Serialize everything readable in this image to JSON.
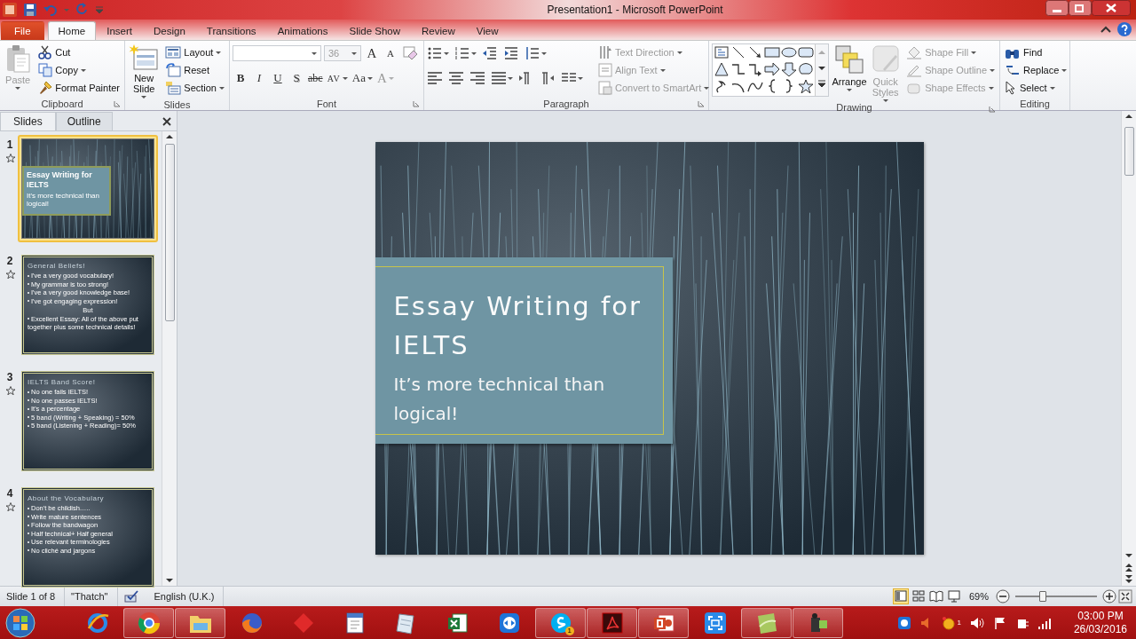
{
  "window": {
    "title": "Presentation1 - Microsoft PowerPoint"
  },
  "ribbon_tabs": [
    {
      "label": "File",
      "kind": "file",
      "selected": false
    },
    {
      "label": "Home",
      "kind": "tab",
      "selected": true
    },
    {
      "label": "Insert",
      "kind": "tab",
      "selected": false
    },
    {
      "label": "Design",
      "kind": "tab",
      "selected": false
    },
    {
      "label": "Transitions",
      "kind": "tab",
      "selected": false
    },
    {
      "label": "Animations",
      "kind": "tab",
      "selected": false
    },
    {
      "label": "Slide Show",
      "kind": "tab",
      "selected": false
    },
    {
      "label": "Review",
      "kind": "tab",
      "selected": false
    },
    {
      "label": "View",
      "kind": "tab",
      "selected": false
    }
  ],
  "ribbon_groups": [
    {
      "title": "Clipboard",
      "kind": "clipboard",
      "launcher": true,
      "commands": [
        {
          "label": "Paste",
          "kind": "large",
          "disabled": true,
          "dropdown": true
        },
        {
          "label": "Cut",
          "kind": "small",
          "disabled": false,
          "dropdown": false
        },
        {
          "label": "Copy",
          "kind": "small",
          "disabled": false,
          "dropdown": true
        },
        {
          "label": "Format Painter",
          "kind": "small",
          "disabled": false,
          "dropdown": false
        }
      ]
    },
    {
      "title": "Slides",
      "kind": "slides",
      "launcher": false,
      "commands": [
        {
          "label": "New Slide",
          "kind": "large",
          "disabled": false,
          "dropdown": true
        },
        {
          "label": "Layout",
          "kind": "small",
          "disabled": false,
          "dropdown": true
        },
        {
          "label": "Reset",
          "kind": "small",
          "disabled": false,
          "dropdown": false
        },
        {
          "label": "Section",
          "kind": "small",
          "disabled": false,
          "dropdown": true
        }
      ]
    },
    {
      "title": "Font",
      "kind": "font",
      "launcher": true,
      "commands": [
        {
          "kind": "font_name",
          "disabled": false,
          "dropdown": true
        },
        {
          "label": "36",
          "kind": "font_size",
          "disabled": true,
          "dropdown": true
        },
        {
          "label": "A",
          "kind": "grow",
          "disabled": false,
          "dropdown": false
        },
        {
          "label": "A",
          "kind": "shrink",
          "disabled": false,
          "dropdown": false
        },
        {
          "kind": "clear",
          "disabled": false,
          "dropdown": false
        },
        {
          "label": "B",
          "kind": "bold",
          "disabled": false,
          "dropdown": false
        },
        {
          "label": "I",
          "kind": "italic",
          "disabled": false,
          "dropdown": false
        },
        {
          "label": "U",
          "kind": "underline",
          "disabled": false,
          "dropdown": false
        },
        {
          "label": "S",
          "kind": "shadow",
          "disabled": false,
          "dropdown": false
        },
        {
          "label": "abc",
          "kind": "strike",
          "disabled": false,
          "dropdown": false
        },
        {
          "label": "AV",
          "kind": "spacing",
          "disabled": false,
          "dropdown": true
        },
        {
          "label": "Aa",
          "kind": "case",
          "disabled": false,
          "dropdown": true
        },
        {
          "label": "A",
          "kind": "color",
          "disabled": true,
          "dropdown": true
        }
      ]
    },
    {
      "title": "Paragraph",
      "kind": "paragraph",
      "launcher": true,
      "commands": [
        {
          "label": "Text Direction",
          "kind": "small",
          "disabled": true,
          "dropdown": true
        },
        {
          "label": "Align Text",
          "kind": "small",
          "disabled": true,
          "dropdown": true
        },
        {
          "label": "Convert to SmartArt",
          "kind": "small",
          "disabled": true,
          "dropdown": true
        }
      ]
    },
    {
      "title": "Drawing",
      "kind": "drawing",
      "launcher": true,
      "commands": [
        {
          "label": "Arrange",
          "kind": "large",
          "disabled": false,
          "dropdown": true
        },
        {
          "label": "Quick Styles",
          "kind": "large",
          "disabled": true,
          "dropdown": true
        },
        {
          "label": "Shape Fill",
          "kind": "small",
          "disabled": true,
          "dropdown": true
        },
        {
          "label": "Shape Outline",
          "kind": "small",
          "disabled": true,
          "dropdown": true
        },
        {
          "label": "Shape Effects",
          "kind": "small",
          "disabled": true,
          "dropdown": true
        }
      ]
    },
    {
      "title": "Editing",
      "kind": "editing",
      "launcher": false,
      "commands": [
        {
          "label": "Find",
          "kind": "small",
          "disabled": false,
          "dropdown": false
        },
        {
          "label": "Replace",
          "kind": "small",
          "disabled": false,
          "dropdown": true
        },
        {
          "label": "Select",
          "kind": "small",
          "disabled": false,
          "dropdown": true
        }
      ]
    }
  ],
  "pane_tabs": [
    {
      "label": "Slides",
      "selected": true
    },
    {
      "label": "Outline",
      "selected": false
    }
  ],
  "slides": [
    {
      "number": "1",
      "kind": "title",
      "selected": true,
      "title": "Essay Writing for IELTS",
      "subtitle": "It's more technical than logical!"
    },
    {
      "number": "2",
      "kind": "bullets",
      "selected": false,
      "title": "General Beliefs!",
      "lines": [
        {
          "text": "I've a very good vocabulary!",
          "kind": "bullet"
        },
        {
          "text": "My grammar is too strong!",
          "kind": "bullet"
        },
        {
          "text": "I've a very good knowledge base!",
          "kind": "bullet"
        },
        {
          "text": "I've got engaging expression!",
          "kind": "bullet"
        },
        {
          "text": "But",
          "kind": "center"
        },
        {
          "text": "Excellent Essay: All of the above put together plus some technical details!",
          "kind": "bullet"
        }
      ]
    },
    {
      "number": "3",
      "kind": "bullets",
      "selected": false,
      "title": "IELTS Band Score!",
      "lines": [
        {
          "text": "No one fails IELTS!",
          "kind": "bullet"
        },
        {
          "text": "No one passes IELTS!",
          "kind": "bullet"
        },
        {
          "text": "It's a percentage",
          "kind": "bullet"
        },
        {
          "text": "5 band (Writing + Speaking) = 50%",
          "kind": "bullet"
        },
        {
          "text": "5 band (Listening + Reading)= 50%",
          "kind": "bullet"
        }
      ]
    },
    {
      "number": "4",
      "kind": "bullets",
      "selected": false,
      "title": "About the Vocabulary",
      "lines": [
        {
          "text": "Don't be childish…..",
          "kind": "bullet"
        },
        {
          "text": "Write mature sentences",
          "kind": "bullet"
        },
        {
          "text": "Follow the bandwagon",
          "kind": "bullet"
        },
        {
          "text": "Half technical+ Half general",
          "kind": "bullet"
        },
        {
          "text": "Use relevant terminologies",
          "kind": "bullet"
        },
        {
          "text": "No cliché and jargons",
          "kind": "bullet"
        }
      ]
    }
  ],
  "current_slide": {
    "title": "Essay Writing for IELTS",
    "subtitle": "It’s more technical than logical!"
  },
  "status_bar": {
    "slide_info": "Slide 1 of 8",
    "theme": "\"Thatch\"",
    "language": "English (U.K.)",
    "views": [
      {
        "selected": true
      },
      {
        "selected": false
      },
      {
        "selected": false
      },
      {
        "selected": false
      }
    ],
    "zoom": {
      "reading": "69%",
      "level": 0.34
    }
  },
  "taskbar": {
    "apps": [
      {
        "running": false
      },
      {
        "running": true
      },
      {
        "running": true
      },
      {
        "running": false
      },
      {
        "running": false
      },
      {
        "running": false
      },
      {
        "running": false
      },
      {
        "running": false
      },
      {
        "running": false
      },
      {
        "running": true,
        "badge": "1"
      },
      {
        "running": true
      },
      {
        "running": true
      },
      {
        "running": false
      },
      {
        "running": true
      },
      {
        "running": true
      }
    ],
    "tray_badge": "1",
    "time": "03:00 PM",
    "date": "26/03/2016"
  }
}
